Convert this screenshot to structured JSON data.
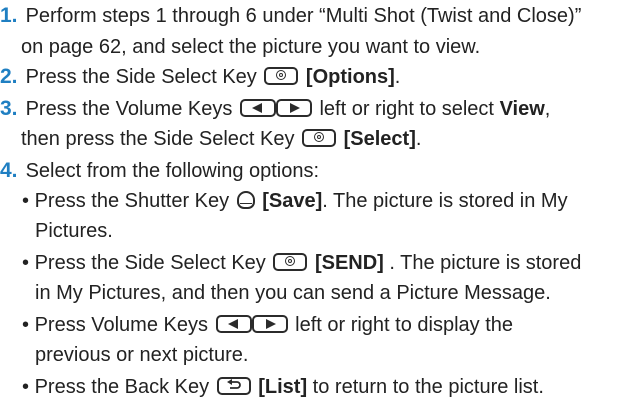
{
  "steps": [
    {
      "number": "1.",
      "line1": "Perform steps 1 through 6 under “Multi Shot (Twist and Close)”",
      "line2": "on page 62, and select the picture you want to view."
    },
    {
      "number": "2.",
      "text_before": "Press the Side Select Key",
      "key_label": "[Options]",
      "text_after": "."
    },
    {
      "number": "3.",
      "text_before": "Press the Volume Keys",
      "text_middle": "left or right to select",
      "bold_word": "View",
      "text_after": ",",
      "line2_before": "then press the Side Select Key",
      "line2_key_label": "[Select]",
      "line2_after": "."
    },
    {
      "number": "4.",
      "text": "Select from the following options:"
    }
  ],
  "options": [
    {
      "bullet": "•",
      "text_before": "Press the Shutter Key",
      "key_label": "[Save]",
      "text_after": ". The picture is stored in My",
      "line2": "Pictures."
    },
    {
      "bullet": "•",
      "text_before": "Press the Side Select Key",
      "key_label": "[SEND]",
      "text_after": " . The picture is stored",
      "line2": "in My Pictures, and then you can send a Picture Message."
    },
    {
      "bullet": "•",
      "text_before": "Press Volume Keys",
      "text_after": "left or right to display the",
      "line2": "previous or next picture."
    },
    {
      "bullet": "•",
      "text_before": "Press the Back Key",
      "key_label": "[List]",
      "text_after": " to return to the picture list."
    }
  ],
  "icons": {
    "side_select_key": "side-select-key-icon",
    "volume_keys": "volume-keys-icon",
    "shutter_key": "shutter-key-icon",
    "back_key": "back-key-icon"
  },
  "colors": {
    "step_number": "#1f7fc2",
    "text": "#222222"
  }
}
